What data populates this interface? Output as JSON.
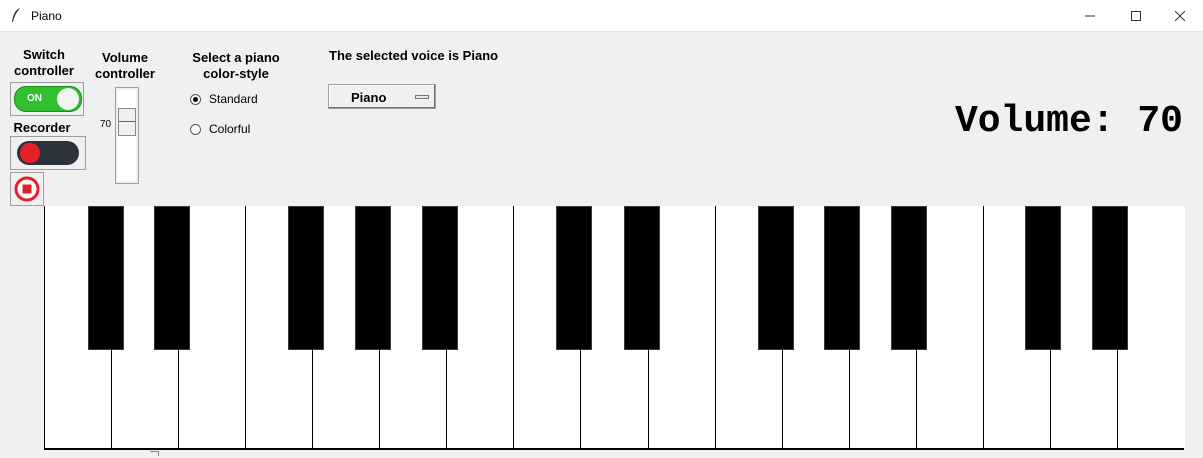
{
  "window": {
    "title": "Piano",
    "icon": "feather-icon",
    "controls": [
      "minimize-icon",
      "maximize-icon",
      "close-icon"
    ]
  },
  "switch_controller": {
    "label": "Switch\ncontroller",
    "toggle_state": "ON"
  },
  "recorder": {
    "label": "Recorder",
    "record_icon": "record-icon",
    "stop_icon": "stop-icon",
    "colors": {
      "record": "#e4202a",
      "toggle_bg": "#2c333c"
    }
  },
  "volume_controller": {
    "label": "Volume\ncontroller",
    "value": "70"
  },
  "color_style": {
    "label": "Select a piano\ncolor-style",
    "options": [
      "Standard",
      "Colorful"
    ],
    "selected": "Standard"
  },
  "voice": {
    "selected_label": "The selected voice is Piano",
    "menu_value": "Piano"
  },
  "volume_display": "Volume: 70",
  "colors": {
    "switch_on": "#2fbf2f",
    "background": "#f0f0f0"
  },
  "piano": {
    "white_keys": 17,
    "black_keys": 12
  }
}
